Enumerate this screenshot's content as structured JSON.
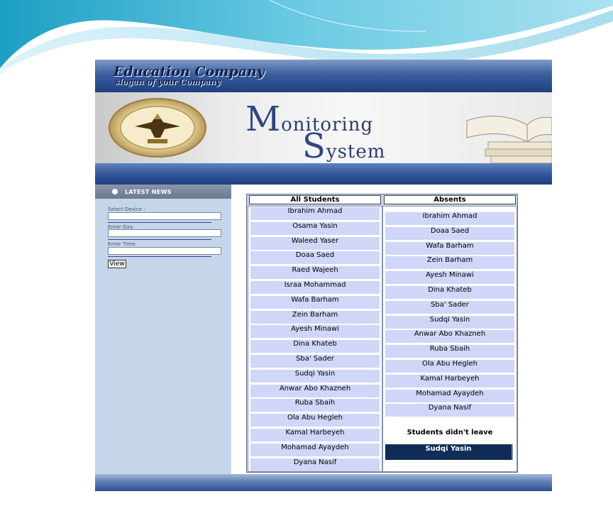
{
  "header": {
    "company_name": "Education Company",
    "slogan": "slogan of your Company"
  },
  "banner": {
    "title_line1_initial": "M",
    "title_line1_rest": "onitoring",
    "title_line2_initial": "S",
    "title_line2_rest": "ystem",
    "logo_icon": "university-seal-icon",
    "decor_icon": "books-icon"
  },
  "sidebar": {
    "title": "LATEST NEWS",
    "device_label": "Select Device :",
    "device_value": "",
    "day_label": "Enter Day:",
    "day_value": "",
    "time_label": "Enter Time:",
    "time_value": "",
    "view_label": "View"
  },
  "lists": {
    "all_students_header": "All Students",
    "absents_header": "Absents",
    "all_students": [
      "Ibrahim Ahmad",
      "Osama Yasin",
      "Waleed Yaser",
      "Doaa Saed",
      "Raed Wajeeh",
      "Israa Mohammad",
      "Wafa Barham",
      "Zein Barham",
      "Ayesh Minawi",
      "Dina Khateb",
      "Sba' Sader",
      "Sudqi Yasin",
      "Anwar Abo Khazneh",
      "Ruba Sbaih",
      "Ola Abu Hegleh",
      "Kamal Harbeyeh",
      "Mohamad Ayaydeh",
      "Dyana Nasif"
    ],
    "absents": [
      "Ibrahim Ahmad",
      "Doaa Saed",
      "Wafa Barham",
      "Zein Barham",
      "Ayesh Minawi",
      "Dina Khateb",
      "Sba' Sader",
      "Sudqi Yasin",
      "Anwar Abo Khazneh",
      "Ruba Sbaih",
      "Ola Abu Hegleh",
      "Kamal Harbeyeh",
      "Mohamad Ayaydeh",
      "Dyana Nasif"
    ],
    "didnt_leave_title": "Students didn't leave",
    "didnt_leave": [
      "Sudqi Yasin"
    ]
  },
  "colors": {
    "header_blue": "#1f3f7e",
    "list_item_bg": "#cfd6f8",
    "sidebar_bg": "#c5d5ea",
    "selected_item_bg": "#0f2d57"
  }
}
